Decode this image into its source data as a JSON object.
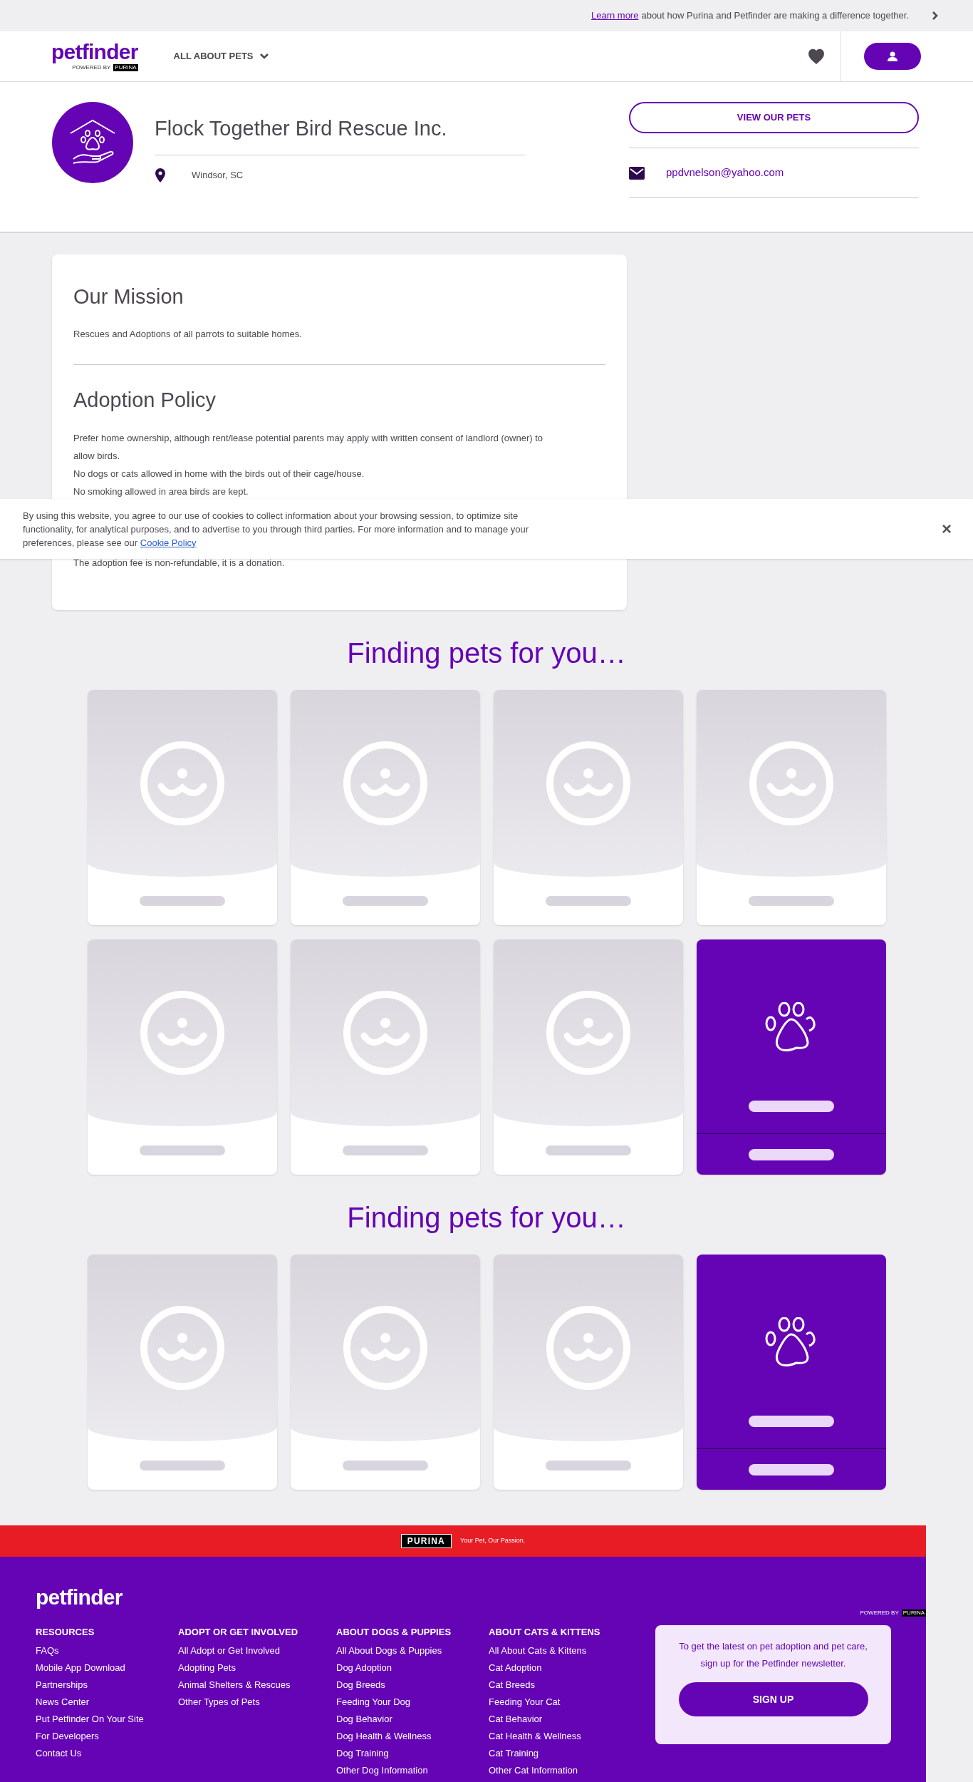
{
  "promo_bar": {
    "link": "Learn more",
    "text": "about how Purina and Petfinder are making a difference together."
  },
  "nav": {
    "logo": "petfinder",
    "logo_sub": "POWERED BY",
    "logo_brand": "PURINA",
    "menu": "ALL ABOUT PETS"
  },
  "org": {
    "name": "Flock Together Bird Rescue Inc.",
    "location": "Windsor, SC",
    "button": "VIEW OUR PETS",
    "email": "ppdvnelson@yahoo.com"
  },
  "mission": {
    "title": "Our Mission",
    "text": "Rescues and Adoptions of all parrots to suitable homes."
  },
  "policy": {
    "title": "Adoption Policy",
    "lines": [
      {
        "kind": "line",
        "text": "Prefer home ownership, although rent/lease potential parents may apply with written consent of landlord (owner) to allow birds."
      },
      {
        "kind": "line",
        "text": "No dogs or cats allowed in home with the birds out of their cage/house."
      },
      {
        "kind": "line",
        "text": "No smoking allowed in area birds are kept."
      },
      {
        "kind": "below_banner",
        "text": "The adoption fee is non-refundable, it is a donation."
      }
    ]
  },
  "cookie_banner": {
    "text": "By using this website, you agree to our use of cookies to collect information about your browsing session, to optimize site functionality, for analytical purposes, and to advertise to you through third parties. For more information and to manage your preferences, please see our",
    "link": "Cookie Policy",
    "close": "×"
  },
  "pet_sections": [
    {
      "heading": "Finding pets for you…",
      "cards": [
        {
          "kind": "placeholder"
        },
        {
          "kind": "placeholder"
        },
        {
          "kind": "placeholder"
        },
        {
          "kind": "placeholder"
        },
        {
          "kind": "placeholder"
        },
        {
          "kind": "placeholder"
        },
        {
          "kind": "placeholder"
        },
        {
          "kind": "promo"
        }
      ]
    },
    {
      "heading": "Finding pets for you…",
      "cards": [
        {
          "kind": "placeholder"
        },
        {
          "kind": "placeholder"
        },
        {
          "kind": "placeholder"
        },
        {
          "kind": "promo"
        }
      ]
    }
  ],
  "purina_band": {
    "brand": "PURINA",
    "tagline": "Your Pet, Our Passion."
  },
  "footer": {
    "logo": "petfinder",
    "logo_sub": "POWERED BY",
    "logo_brand": "PURINA",
    "columns": [
      {
        "title": "RESOURCES",
        "links": [
          "FAQs",
          "Mobile App Download",
          "Partnerships",
          "News Center",
          "Put Petfinder On Your Site",
          "For Developers",
          "Contact Us"
        ]
      },
      {
        "title": "ADOPT OR GET INVOLVED",
        "links": [
          "All Adopt or Get Involved",
          "Adopting Pets",
          "Animal Shelters & Rescues",
          "Other Types of Pets"
        ]
      },
      {
        "title": "ABOUT DOGS & PUPPIES",
        "links": [
          "All About Dogs & Puppies",
          "Dog Adoption",
          "Dog Breeds",
          "Feeding Your Dog",
          "Dog Behavior",
          "Dog Health & Wellness",
          "Dog Training",
          "Other Dog Information"
        ]
      },
      {
        "title": "ABOUT CATS & KITTENS",
        "links": [
          "All About Cats & Kittens",
          "Cat Adoption",
          "Cat Breeds",
          "Feeding Your Cat",
          "Cat Behavior",
          "Cat Health & Wellness",
          "Cat Training",
          "Other Cat Information"
        ]
      }
    ],
    "newsletter": {
      "text": "To get the latest on pet adoption and pet care, sign up for the Petfinder newsletter.",
      "button": "SIGN UP"
    }
  }
}
